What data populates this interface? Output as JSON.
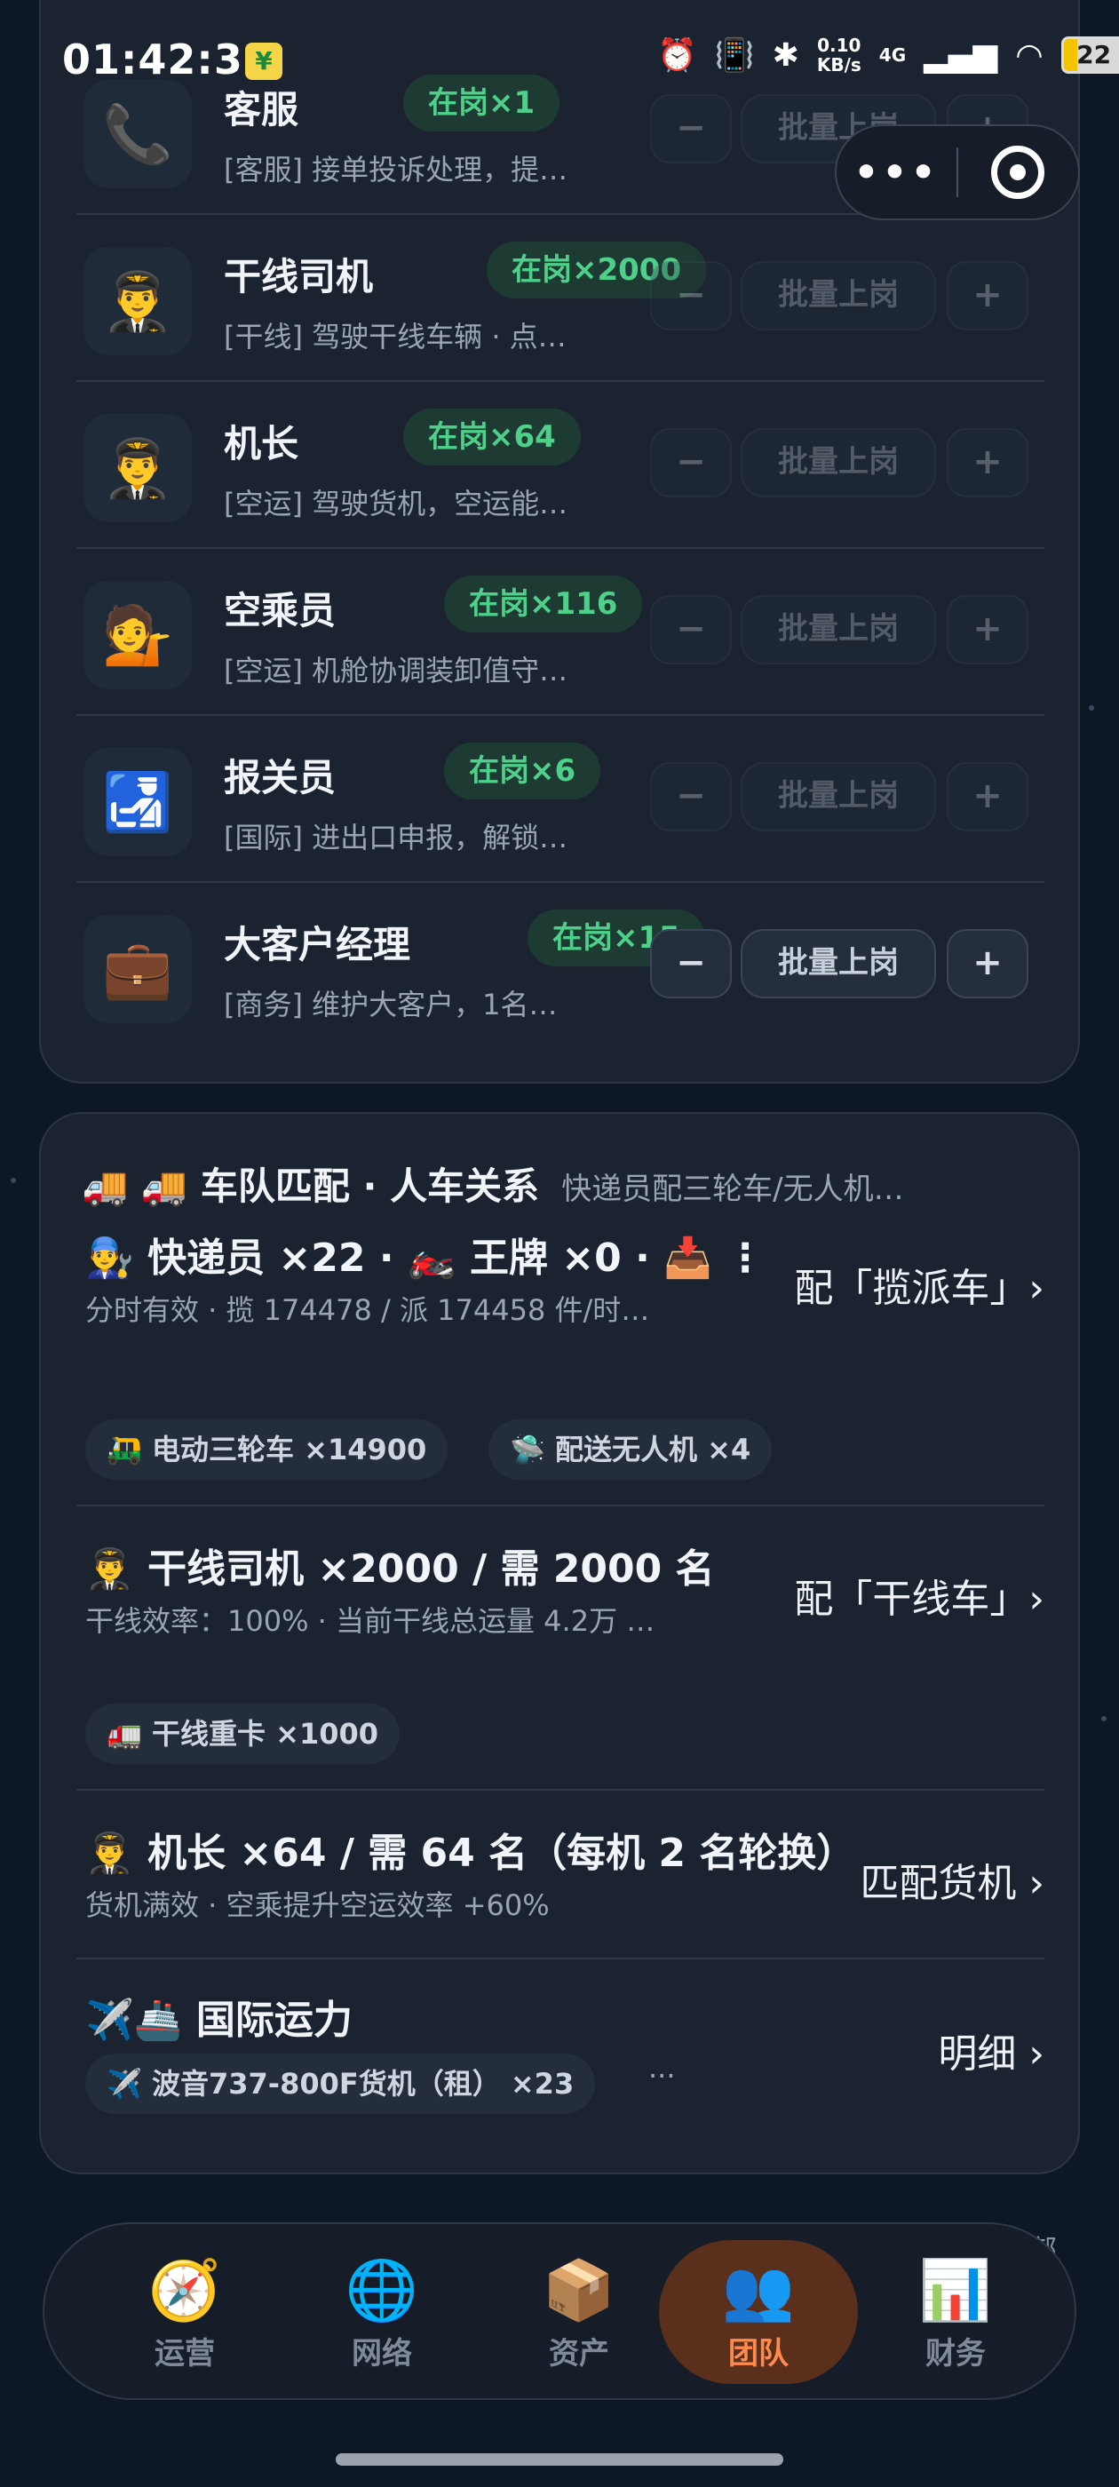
{
  "status_bar": {
    "time": "01:42:32",
    "net_speed_value": "0.10",
    "net_speed_unit": "KB/s",
    "network": "4G",
    "battery": "22"
  },
  "capsule": {
    "more": "•••"
  },
  "staff_rows": [
    {
      "icon": "📞",
      "title": "客服",
      "badge": "在岗×1",
      "desc": "[客服] 接单投诉处理，提…",
      "minus": "−",
      "batch": "批量上岗",
      "plus": "+",
      "enabled": false
    },
    {
      "icon": "👨‍✈️",
      "title": "干线司机",
      "badge": "在岗×2000",
      "desc": "[干线] 驾驶干线车辆 · 点…",
      "minus": "−",
      "batch": "批量上岗",
      "plus": "+",
      "enabled": false
    },
    {
      "icon": "👨‍✈️",
      "title": "机长",
      "badge": "在岗×64",
      "desc": "[空运] 驾驶货机，空运能…",
      "minus": "−",
      "batch": "批量上岗",
      "plus": "+",
      "enabled": false
    },
    {
      "icon": "💁",
      "title": "空乘员",
      "badge": "在岗×116",
      "desc": "[空运] 机舱协调装卸值守…",
      "minus": "−",
      "batch": "批量上岗",
      "plus": "+",
      "enabled": false
    },
    {
      "icon": "🛃",
      "title": "报关员",
      "badge": "在岗×6",
      "desc": "[国际] 进出口申报，解锁…",
      "minus": "−",
      "batch": "批量上岗",
      "plus": "+",
      "enabled": false
    },
    {
      "icon": "💼",
      "title": "大客户经理",
      "badge": "在岗×15",
      "desc": "[商务] 维护大客户，1名…",
      "minus": "−",
      "batch": "批量上岗",
      "plus": "+",
      "enabled": true
    }
  ],
  "fleet": {
    "title": "🚚 🚚 车队匹配 · 人车关系",
    "subtitle": "快递员配三轮车/无人机…",
    "courier": {
      "title": "👨‍🔧 快递员 ×22 · 🏍️ 王牌 ×0 · 📥 ⋮",
      "desc": "分时有效 · 揽 174478 / 派 174458 件/时…",
      "action": "配「揽派车」›",
      "chips": [
        "🛺 电动三轮车 ×14900",
        "🛸 配送无人机 ×4"
      ]
    },
    "trunk": {
      "title": "👨‍✈️ 干线司机  ×2000 / 需 2000 名",
      "desc": "干线效率：100% · 当前干线总运量 4.2万 …",
      "action": "配「干线车」›",
      "chips": [
        "🚛 干线重卡 ×1000"
      ]
    },
    "captain": {
      "title": "👨‍✈️ 机长 ×64 / 需 64 名（每机 2 名轮换）",
      "desc": "货机满效 · 空乘提升空运效率 +60%",
      "action": "匹配货机 ›"
    },
    "intl": {
      "title": "✈️🚢 国际运力",
      "action": "明细 ›",
      "chips": [
        "✈️ 波音737-800F货机（租） ×23"
      ],
      "more": "···"
    }
  },
  "nav": [
    {
      "icon": "🧭",
      "label": "运营",
      "active": false
    },
    {
      "icon": "🌐",
      "label": "网络",
      "active": false
    },
    {
      "icon": "📦",
      "label": "资产",
      "active": false
    },
    {
      "icon": "👥",
      "label": "团队",
      "active": true
    },
    {
      "icon": "📊",
      "label": "财务",
      "active": false
    }
  ],
  "side_text": "部"
}
